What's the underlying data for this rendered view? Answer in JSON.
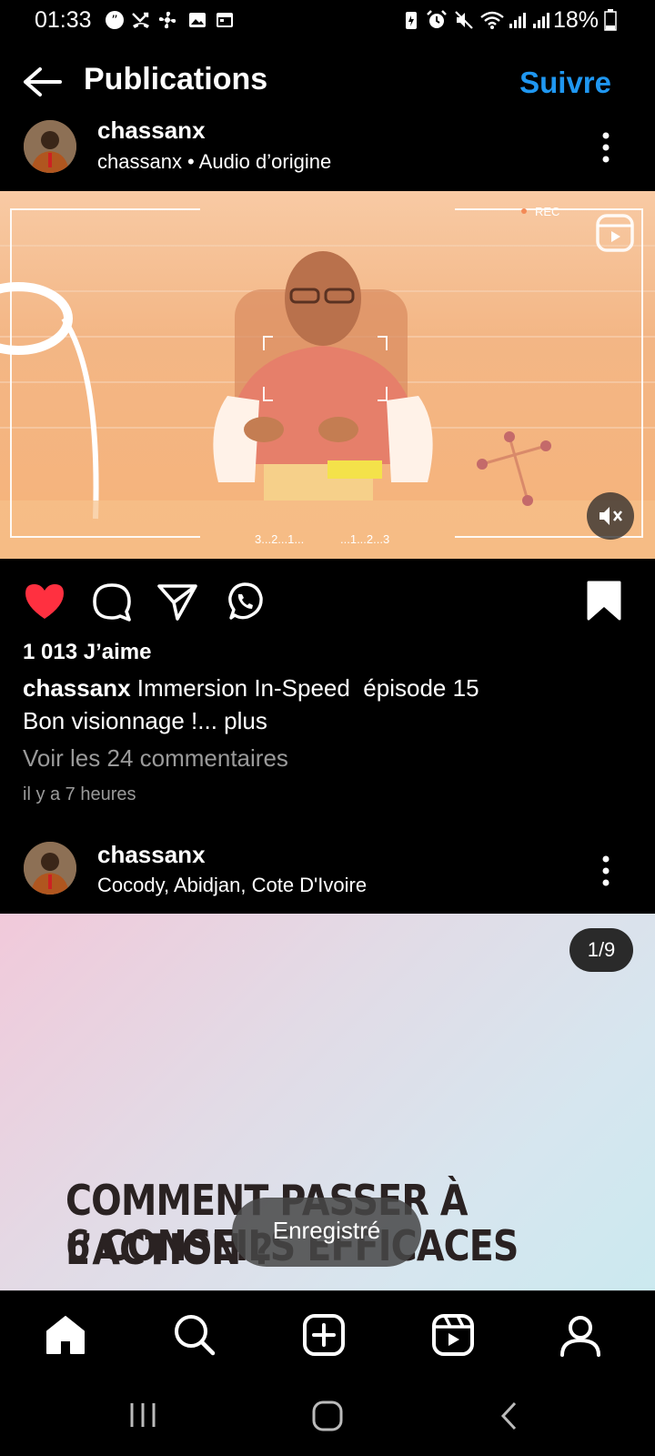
{
  "status_bar": {
    "time": "01:33",
    "battery": "18%"
  },
  "header": {
    "title": "Publications",
    "follow_label": "Suivre"
  },
  "post1": {
    "username": "chassanx",
    "subline": "chassanx • Audio d’origine",
    "media_overlay_left": "3...2...1...",
    "media_overlay_right": "...1...2...3",
    "media_rec": "REC",
    "likes": "1 013 J’aime",
    "caption_user": "chassanx",
    "caption_text": " Immersion In-Speed  épisode 15",
    "caption_line2": "Bon visionnage !... plus",
    "comments_link": "Voir les 24 commentaires",
    "time_ago": "il y a 7 heures"
  },
  "post2": {
    "username": "chassanx",
    "location": "Cocody, Abidjan, Cote D'Ivoire",
    "counter": "1/9",
    "heading_line1": "COMMENT PASSER À L’ACTION ?",
    "heading_line2": "6 CONSEILS EFFICACES"
  },
  "toast": "Enregistré",
  "colors": {
    "accent": "#1f97f1",
    "like": "#ff3040",
    "background": "#000000"
  }
}
